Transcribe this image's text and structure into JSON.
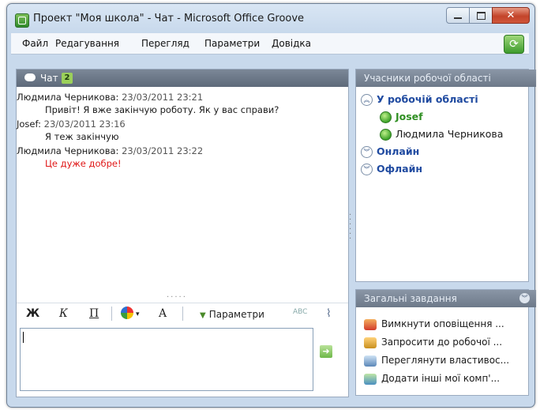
{
  "window": {
    "title": "Проект \"Моя школа\" - Чат - Microsoft Office Groove",
    "min_icon": "minimize-icon",
    "max_icon": "maximize-icon",
    "close_icon": "close-icon"
  },
  "menu": {
    "items": [
      "Файл",
      "Редагування",
      "Перегляд",
      "Параметри",
      "Довідка"
    ]
  },
  "chat": {
    "tab_label": "Чат",
    "badge": "2",
    "messages": [
      {
        "author": "Людмила Черникова:",
        "time": "23/03/2011 23:21",
        "text": "Привіт! Я вже закінчую роботу. Як у вас справи?"
      },
      {
        "author": "Josef:",
        "time": "23/03/2011 23:16",
        "text": "Я теж закінчую"
      },
      {
        "author": "Людмила Черникова:",
        "time": "23/03/2011 23:22",
        "text": "Це дуже добре!"
      }
    ],
    "toolbar": {
      "bold": "Ж",
      "italic": "К",
      "underline": "П",
      "font_size": "A",
      "params": "Параметри"
    },
    "input_value": ""
  },
  "members": {
    "title": "Учасники робочої області",
    "groups": [
      {
        "label": "У робочій області",
        "members": [
          "Josef",
          "Людмила Черникова"
        ]
      },
      {
        "label": "Онлайн",
        "members": []
      },
      {
        "label": "Офлайн",
        "members": []
      }
    ]
  },
  "tasks": {
    "title": "Загальні завдання",
    "items": [
      "Вимкнути оповіщення ...",
      "Запросити до робочої ...",
      "Переглянути властивос...",
      "Додати інші мої комп'..."
    ]
  },
  "colors": {
    "accent_green": "#3fa32a",
    "link_blue": "#1f4aa0",
    "highlight_red": "#e01818"
  }
}
